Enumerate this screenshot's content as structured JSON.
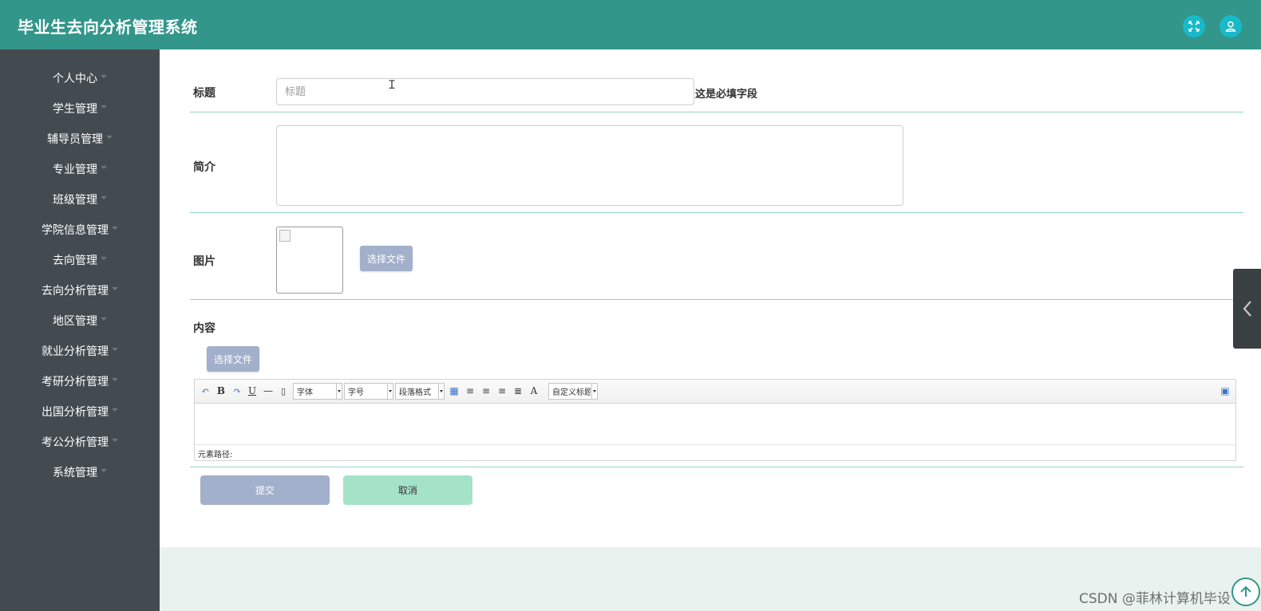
{
  "header": {
    "title": "毕业生去向分析管理系统",
    "fullscreen_icon": "fullscreen-icon",
    "user_icon": "user-icon",
    "accent_color": "#32968a",
    "button_color": "#18b9c9"
  },
  "sidebar": {
    "background": "#444b50",
    "items": [
      {
        "label": "个人中心"
      },
      {
        "label": "学生管理"
      },
      {
        "label": "辅导员管理"
      },
      {
        "label": "专业管理"
      },
      {
        "label": "班级管理"
      },
      {
        "label": "学院信息管理"
      },
      {
        "label": "去向管理"
      },
      {
        "label": "去向分析管理"
      },
      {
        "label": "地区管理"
      },
      {
        "label": "就业分析管理"
      },
      {
        "label": "考研分析管理"
      },
      {
        "label": "出国分析管理"
      },
      {
        "label": "考公分析管理"
      },
      {
        "label": "系统管理"
      }
    ]
  },
  "form": {
    "title_label": "标题",
    "title_placeholder": "标题",
    "title_value": "",
    "required_note": "这是必填字段",
    "intro_label": "简介",
    "intro_value": "",
    "image_label": "图片",
    "image_file_button": "选择文件",
    "content_label": "内容",
    "content_file_button": "选择文件",
    "submit_label": "提交",
    "cancel_label": "取消"
  },
  "editor": {
    "font_select": "字体",
    "size_select": "字号",
    "paragraph_select": "段落格式",
    "custom_title_select": "自定义标题",
    "path_label": "元素路径:",
    "content": ""
  },
  "watermark": "CSDN @菲林计算机毕设"
}
